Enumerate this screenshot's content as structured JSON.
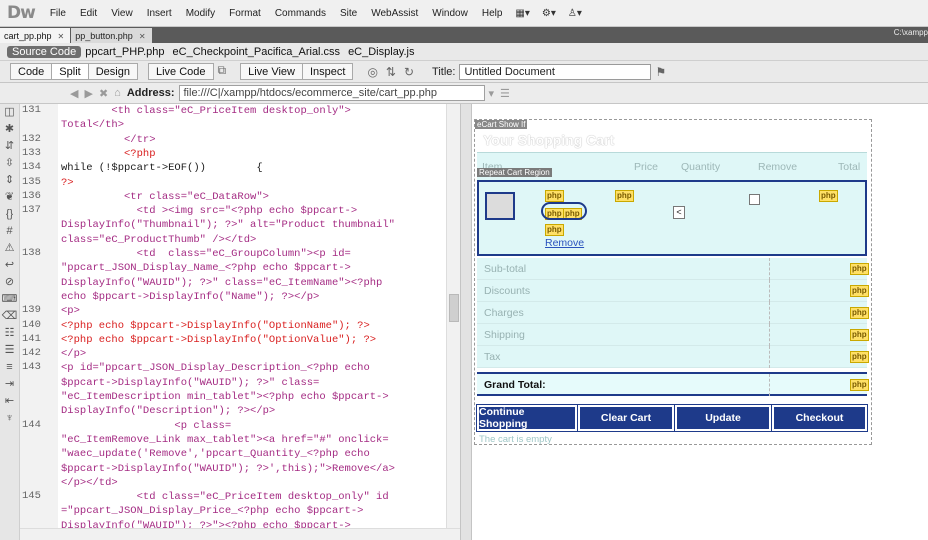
{
  "app": {
    "logo": "Dw",
    "menu": [
      "File",
      "Edit",
      "View",
      "Insert",
      "Modify",
      "Format",
      "Commands",
      "Site",
      "WebAssist",
      "Window",
      "Help"
    ],
    "tool_icons": [
      "▦▾",
      "⚙▾",
      "♙▾"
    ]
  },
  "doc_tabs": [
    {
      "label": "cart_pp.php",
      "active": true
    },
    {
      "label": "pp_button.php",
      "active": false
    }
  ],
  "doc_path_right": "C:\\xampp",
  "related_files": [
    "Source Code",
    "ppcart_PHP.php",
    "eC_Checkpoint_Pacifica_Arial.css",
    "eC_Display.js"
  ],
  "toolbar": {
    "views": [
      "Code",
      "Split",
      "Design"
    ],
    "live_code": "Live Code",
    "live_view": "Live View",
    "inspect": "Inspect",
    "title_label": "Title:",
    "title_value": "Untitled Document"
  },
  "address": {
    "label": "Address:",
    "value": "file:///C|/xampp/htdocs/ecommerce_site/cart_pp.php"
  },
  "line_numbers": [
    "131",
    "132",
    "133",
    "134",
    "135",
    "136",
    "137",
    "138",
    "139",
    "140",
    "141",
    "142",
    "143",
    "144",
    "145"
  ],
  "code_lines": [
    "        <th class=\"eC_PriceItem desktop_only\">",
    "Total</th>",
    "          </tr>",
    "          <?php",
    "while (!$ppcart->EOF())        {",
    "?>",
    "          <tr class=\"eC_DataRow\">",
    "            <td ><img src=\"<?php echo $ppcart->",
    "DisplayInfo(\"Thumbnail\"); ?>\" alt=\"Product thumbnail\"",
    "class=\"eC_ProductThumb\" /></td>",
    "            <td  class=\"eC_GroupColumn\"><p id=",
    "\"ppcart_JSON_Display_Name_<?php echo $ppcart->",
    "DisplayInfo(\"WAUID\"); ?>\" class=\"eC_ItemName\"><?php",
    "echo $ppcart->DisplayInfo(\"Name\"); ?></p>",
    "<p>",
    "<?php echo $ppcart->DisplayInfo(\"OptionName\"); ?>",
    "<?php echo $ppcart->DisplayInfo(\"OptionValue\"); ?>",
    "</p>",
    "<p id=\"ppcart_JSON_Display_Description_<?php echo",
    "$ppcart->DisplayInfo(\"WAUID\"); ?>\" class=",
    "\"eC_ItemDescription min_tablet\"><?php echo $ppcart->",
    "DisplayInfo(\"Description\"); ?></p>",
    "                  <p class=",
    "\"eC_ItemRemove_Link max_tablet\"><a href=\"#\" onclick=",
    "\"waec_update('Remove','ppcart_Quantity_<?php echo",
    "$ppcart->DisplayInfo(\"WAUID\"); ?>',this);\">Remove</a>",
    "</p></td>",
    "            <td class=\"eC_PriceItem desktop_only\" id",
    "=\"ppcart_JSON_Display_Price_<?php echo $ppcart->",
    "DisplayInfo(\"WAUID\"); ?>\"><?php echo $ppcart->"
  ],
  "design": {
    "region_tag": "eCart Show If",
    "cart_title": "Your Shopping Cart",
    "headers": [
      "Item",
      "Price",
      "Quantity",
      "Remove",
      "Total"
    ],
    "repeat_tag": "Repeat Cart Region",
    "php_badge": "php",
    "remove_link": "Remove",
    "qty_value": "<",
    "summary": [
      "Sub-total",
      "Discounts",
      "Charges",
      "Shipping",
      "Tax"
    ],
    "grand_total": "Grand Total:",
    "buttons": [
      "Continue Shopping",
      "Clear Cart",
      "Update",
      "Checkout"
    ],
    "empty_msg": "The cart is empty"
  },
  "colors": {
    "highlight": "#fff200",
    "cart_bg": "#dff7f7",
    "button_bg": "#1e3a8a",
    "annotation": "#1e3a8a"
  }
}
